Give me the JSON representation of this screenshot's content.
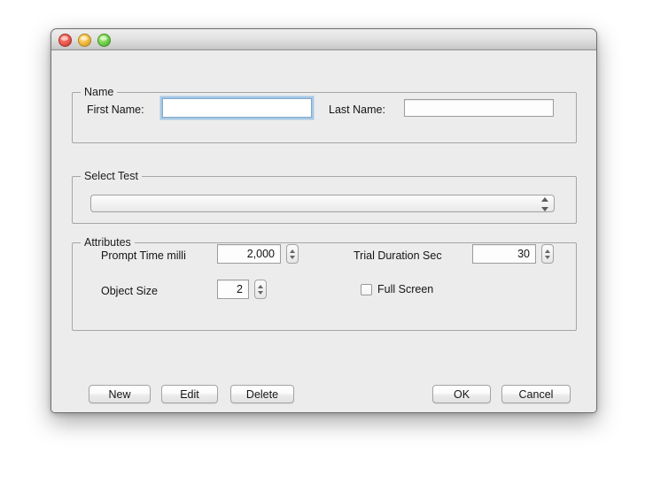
{
  "window": {
    "traffic_lights": [
      {
        "name": "close-button",
        "color": "#e8574c"
      },
      {
        "name": "minimize-button",
        "color": "#f0b73c"
      },
      {
        "name": "zoom-button",
        "color": "#6fce49"
      }
    ]
  },
  "name_group": {
    "legend": "Name",
    "first_name_label": "First Name:",
    "first_name_value": "",
    "first_name_placeholder": "",
    "last_name_label": "Last Name:",
    "last_name_value": "",
    "last_name_placeholder": ""
  },
  "select_test_group": {
    "legend": "Select Test",
    "combo_value": "",
    "combo_options": [
      ""
    ]
  },
  "attributes_group": {
    "legend": "Attributes",
    "prompt_time_label": "Prompt Time milli",
    "prompt_time_value": "2,000",
    "trial_duration_label": "Trial Duration Sec",
    "trial_duration_value": "30",
    "object_size_label": "Object Size",
    "object_size_value": "2",
    "full_screen_label": "Full Screen",
    "full_screen_checked": false
  },
  "buttons": {
    "new_label": "New",
    "edit_label": "Edit",
    "delete_label": "Delete",
    "ok_label": "OK",
    "cancel_label": "Cancel"
  }
}
